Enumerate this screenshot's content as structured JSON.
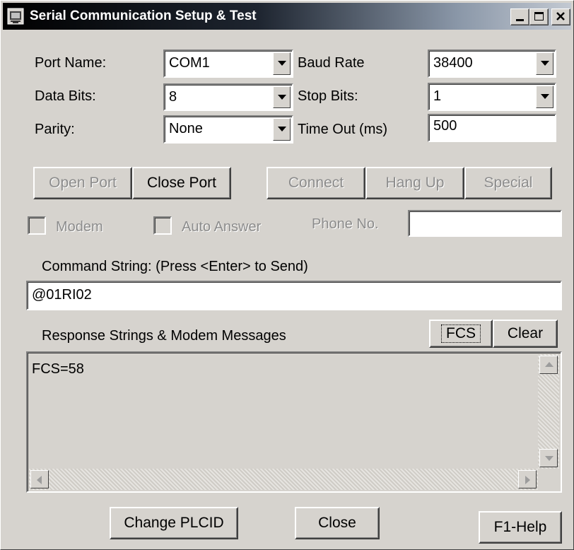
{
  "window": {
    "title": "Serial Communication Setup & Test"
  },
  "settings": {
    "port_name_label": "Port Name:",
    "port_name_value": "COM1",
    "baud_rate_label": "Baud Rate",
    "baud_rate_value": "38400",
    "data_bits_label": "Data Bits:",
    "data_bits_value": "8",
    "stop_bits_label": "Stop Bits:",
    "stop_bits_value": "1",
    "parity_label": "Parity:",
    "parity_value": "None",
    "timeout_label": "Time Out (ms)",
    "timeout_value": "500"
  },
  "buttons": {
    "open_port": "Open Port",
    "close_port": "Close Port",
    "connect": "Connect",
    "hang_up": "Hang Up",
    "special": "Special",
    "fcs": "FCS",
    "clear": "Clear",
    "change_plcid": "Change PLCID",
    "close": "Close",
    "help": "F1-Help"
  },
  "modem": {
    "modem_label": "Modem",
    "auto_answer_label": "Auto Answer",
    "phone_label": "Phone No.",
    "phone_value": ""
  },
  "command": {
    "label": "Command String: (Press <Enter> to Send)",
    "value": "@01RI02"
  },
  "response": {
    "label": "Response Strings & Modem Messages",
    "text": "FCS=58"
  }
}
